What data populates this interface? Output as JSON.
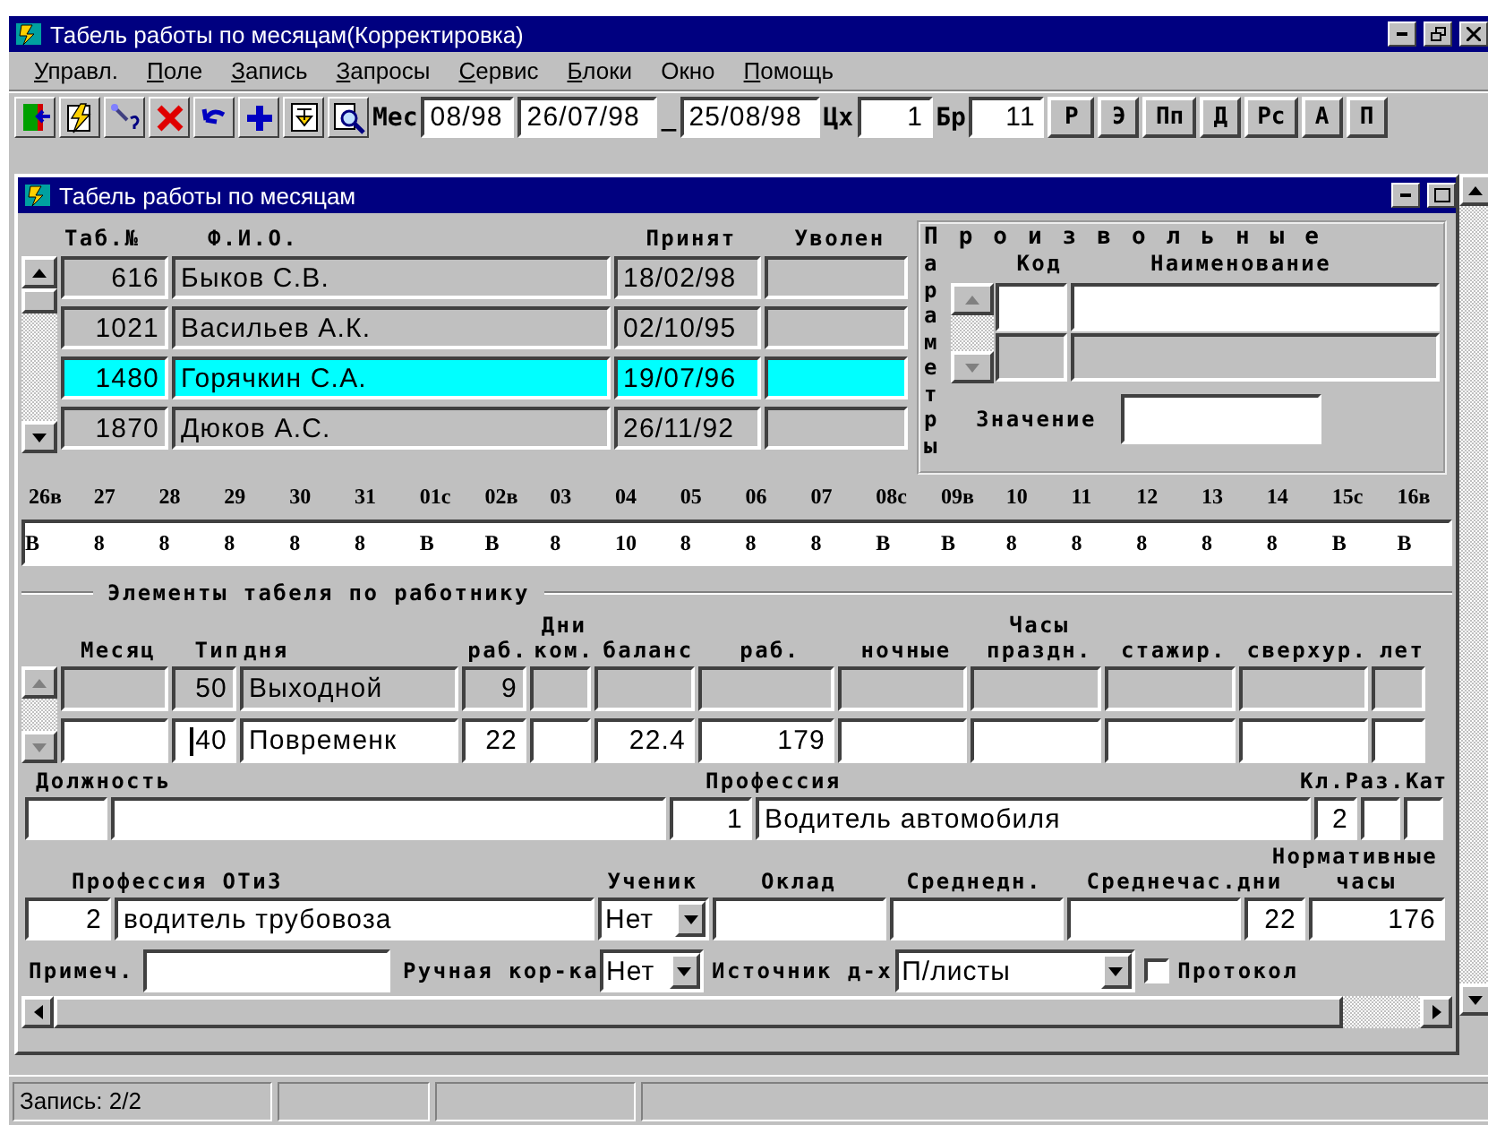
{
  "window": {
    "title": "Табель работы по месяцам(Корректировка)"
  },
  "menu": [
    {
      "label": "Управл.",
      "mnemonic": true
    },
    {
      "label": "Поле",
      "mnemonic": true
    },
    {
      "label": "Запись",
      "mnemonic": true
    },
    {
      "label": "Запросы",
      "mnemonic": true
    },
    {
      "label": "Сервис",
      "mnemonic": true
    },
    {
      "label": "Блоки",
      "mnemonic": true
    },
    {
      "label": "Окно",
      "mnemonic": false
    },
    {
      "label": "Помощь",
      "mnemonic": true
    }
  ],
  "toolbar": {
    "month_label": "Мес",
    "month": "08/98",
    "date_from": "26/07/98",
    "dash": "_",
    "date_to": "25/08/98",
    "shop_label": "Цх",
    "shop": "1",
    "brigade_label": "Бр",
    "brigade": "11",
    "buttons": [
      "Р",
      "Э",
      "Пп",
      "Д",
      "Рс",
      "А",
      "П"
    ]
  },
  "form": {
    "title": "Табель работы по месяцам"
  },
  "employees": {
    "columns": [
      "Таб.№",
      "Ф.И.О.",
      "Принят",
      "Уволен"
    ],
    "rows": [
      {
        "tab": "616",
        "name": "Быков С.В.",
        "hired": "18/02/98",
        "selected": false
      },
      {
        "tab": "1021",
        "name": "Васильев А.К.",
        "hired": "02/10/95",
        "selected": false
      },
      {
        "tab": "1480",
        "name": "Горячкин С.А.",
        "hired": "19/07/96",
        "selected": true
      },
      {
        "tab": "1870",
        "name": "Дюков А.С.",
        "hired": "26/11/92",
        "selected": false
      }
    ]
  },
  "params": {
    "title_across": "Произвольные",
    "title_down": "араметры",
    "columns": [
      "Код",
      "Наименование"
    ],
    "value_label": "Значение"
  },
  "days": {
    "labels": [
      "26в",
      "27",
      "28",
      "29",
      "30",
      "31",
      "01с",
      "02в",
      "03",
      "04",
      "05",
      "06",
      "07",
      "08с",
      "09в",
      "10",
      "11",
      "12",
      "13",
      "14",
      "15с",
      "16в"
    ],
    "values": [
      "В",
      "8",
      "8",
      "8",
      "8",
      "8",
      "В",
      "В",
      "8",
      "10",
      "8",
      "8",
      "8",
      "В",
      "В",
      "8",
      "8",
      "8",
      "8",
      "8",
      "В",
      "В"
    ]
  },
  "elements": {
    "title": "Элементы табеля по работнику",
    "columns": [
      {
        "label": "Месяц"
      },
      {
        "label": "Тип"
      },
      {
        "label": "дня"
      },
      {
        "label": "раб."
      },
      {
        "label": "ком.",
        "top": "Дни"
      },
      {
        "label": "баланс"
      },
      {
        "label": "раб."
      },
      {
        "label": "ночные"
      },
      {
        "label": "праздн.",
        "top": "Часы"
      },
      {
        "label": "стажир."
      },
      {
        "label": "сверхур."
      },
      {
        "label": "лет"
      }
    ],
    "rows": [
      {
        "selected": false,
        "type_code": "50",
        "type_name": "Выходной",
        "work_days": "9"
      },
      {
        "selected": true,
        "type_code": "40",
        "type_name": "Повременк",
        "work_days": "22",
        "balance": "22.4",
        "work_hours": "179"
      }
    ]
  },
  "position": {
    "position_label": "Должность",
    "profession_label": "Профессия",
    "profession_code": "1",
    "profession": "Водитель автомобиля",
    "class_label": "Кл.",
    "rank_label": "Раз.",
    "category_label": "Кат",
    "class": "2"
  },
  "otiz": {
    "label": "Профессия ОТиЗ",
    "code": "2",
    "name": "водитель трубовоза",
    "student_label": "Ученик",
    "student": "Нет",
    "salary_label": "Оклад",
    "daily_label": "Среднедн.",
    "hourly_label": "Среднечас.",
    "norm_label": "Нормативные",
    "norm_days_label": "дни",
    "norm_hours_label": "часы",
    "norm_days": "22",
    "norm_hours": "176"
  },
  "bottom": {
    "note_label": "Примеч.",
    "manual_label": "Ручная кор-ка",
    "manual": "Нет",
    "source_label": "Источник д-х",
    "source": "П/листы",
    "protocol_label": "Протокол",
    "protocol_checked": false
  },
  "status_bar": [
    "Запись: 2/2"
  ]
}
